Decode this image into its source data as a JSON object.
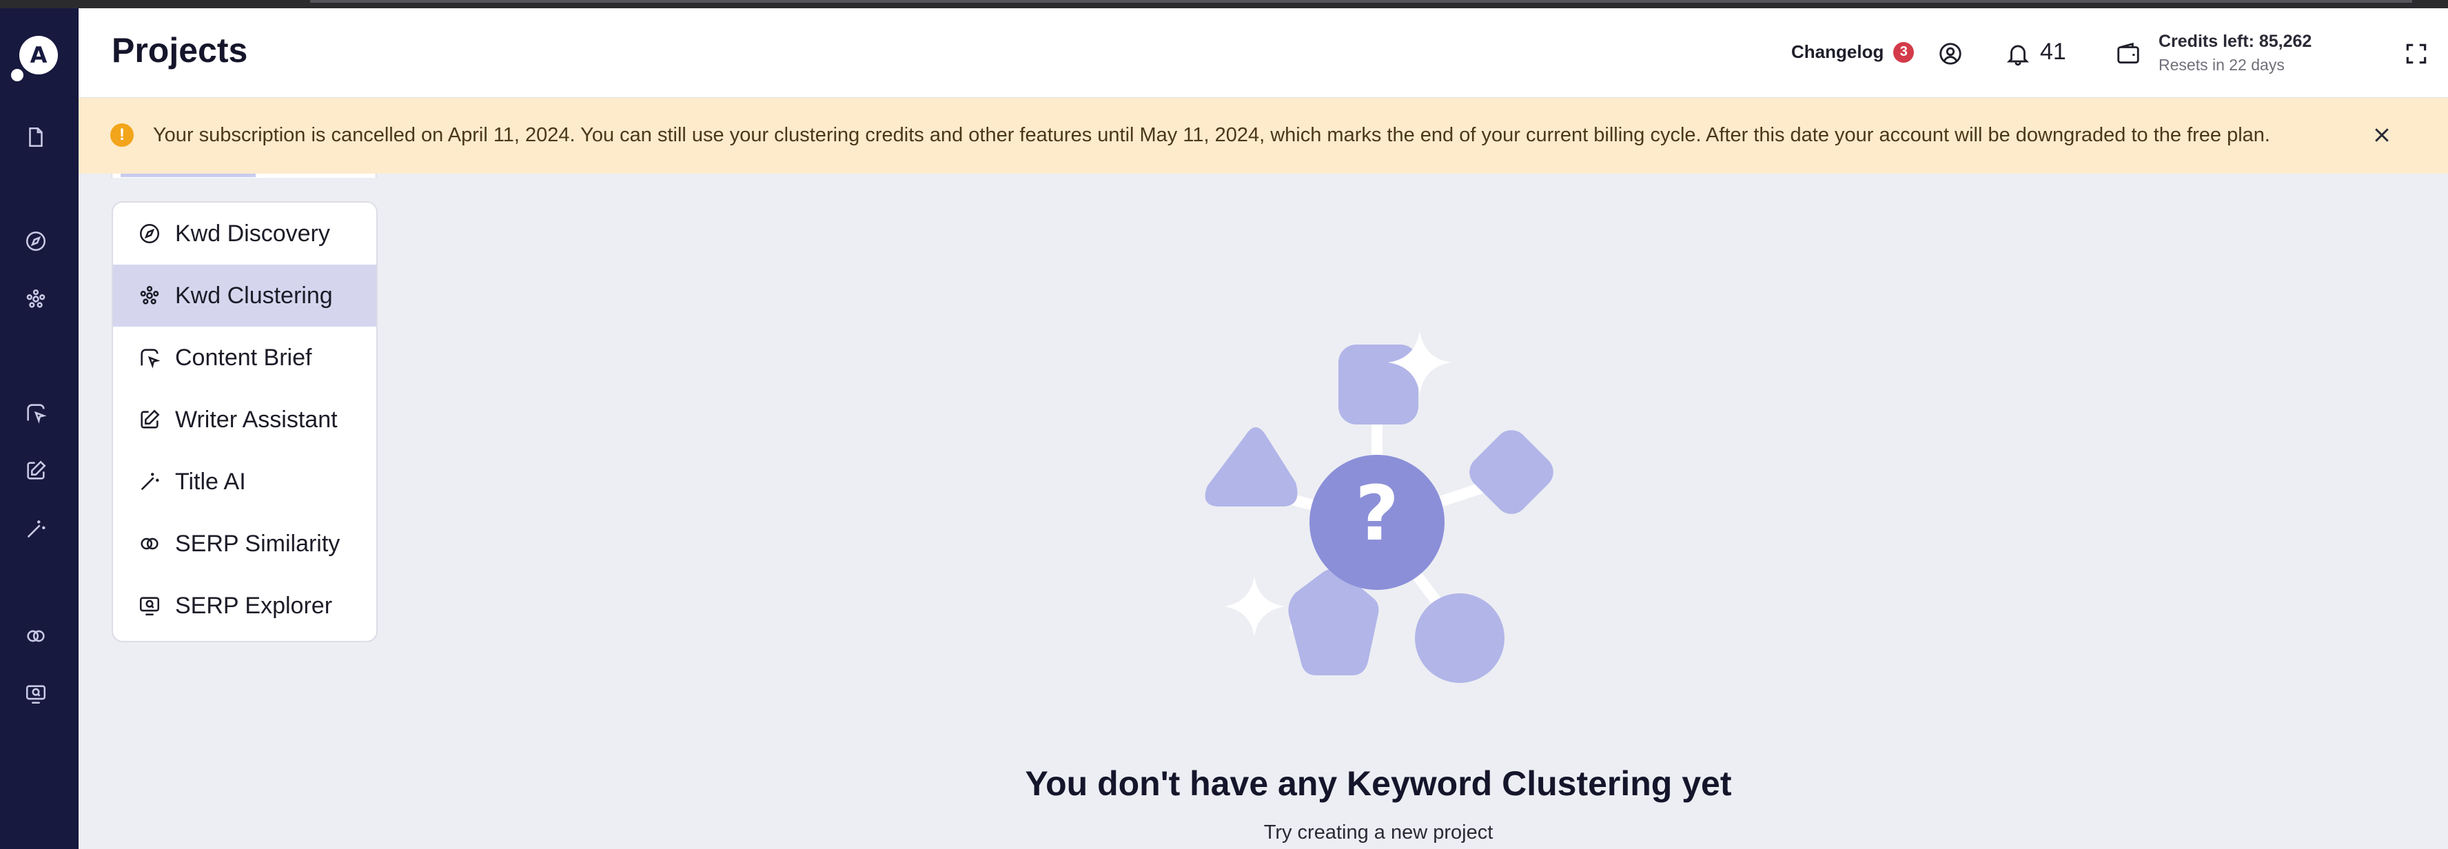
{
  "header": {
    "title": "Projects",
    "changelog_label": "Changelog",
    "changelog_count": "3",
    "notifications_count": "41",
    "credits_left": "Credits left: 85,262",
    "credits_reset": "Resets in 22 days"
  },
  "banner": {
    "message": "Your subscription is cancelled on April 11, 2024. You can still use your clustering credits and other features until May 11, 2024, which marks the end of your current billing cycle. After this date your account will be downgraded to the free plan.",
    "warn_glyph": "!",
    "color": "#fdebcc"
  },
  "logo": {
    "glyph": "A"
  },
  "menu": {
    "items": [
      {
        "label": "Kwd Discovery",
        "icon": "compass-icon"
      },
      {
        "label": "Kwd Clustering",
        "icon": "cluster-icon"
      },
      {
        "label": "Content Brief",
        "icon": "brief-icon"
      },
      {
        "label": "Writer Assistant",
        "icon": "edit-icon"
      },
      {
        "label": "Title AI",
        "icon": "magic-wand-icon"
      },
      {
        "label": "SERP Similarity",
        "icon": "link-rings-icon"
      },
      {
        "label": "SERP Explorer",
        "icon": "monitor-search-icon"
      }
    ],
    "active": "Kwd Clustering"
  },
  "empty_state": {
    "title": "You don't have any Keyword Clustering yet",
    "subtitle": "Try creating a new project",
    "icon_glyph": "?"
  },
  "colors": {
    "sidebar": "#17193f",
    "accent": "#8b8fd8",
    "accent_light": "#b2b5e8",
    "active_menu": "#d5d6ee",
    "badge": "#d33b4a",
    "warning": "#f2a51a"
  }
}
